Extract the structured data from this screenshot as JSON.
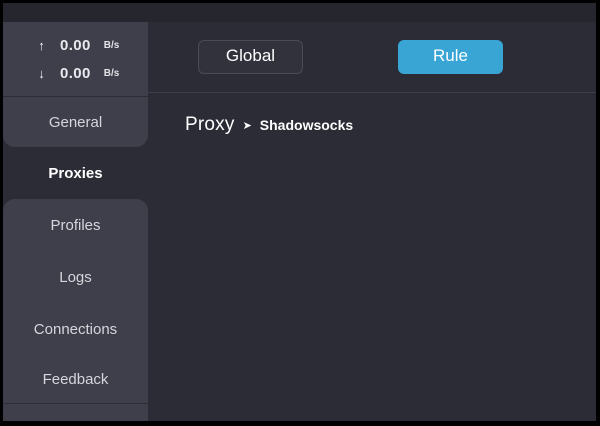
{
  "colors": {
    "accent_blue": "#38a5d5",
    "window_bg": "#2b2c36",
    "sidebar_panel_bg": "#3e3f4a",
    "titlebar_bg": "#26262e"
  },
  "traffic": {
    "upload": {
      "icon": "up-arrow-icon",
      "glyph": "↑",
      "value": "0.00",
      "unit": "B/s"
    },
    "download": {
      "icon": "down-arrow-icon",
      "glyph": "↓",
      "value": "0.00",
      "unit": "B/s"
    }
  },
  "sidebar": {
    "items": [
      {
        "label": "General",
        "active": false
      },
      {
        "label": "Proxies",
        "active": true
      },
      {
        "label": "Profiles",
        "active": false
      },
      {
        "label": "Logs",
        "active": false
      },
      {
        "label": "Connections",
        "active": false
      },
      {
        "label": "Feedback",
        "active": false
      }
    ]
  },
  "header": {
    "mode_buttons": [
      {
        "label": "Global",
        "selected": false
      },
      {
        "label": "Rule",
        "selected": true
      }
    ]
  },
  "content": {
    "breadcrumb": {
      "section": "Proxy",
      "separator": "➤",
      "current": "Shadowsocks"
    }
  }
}
